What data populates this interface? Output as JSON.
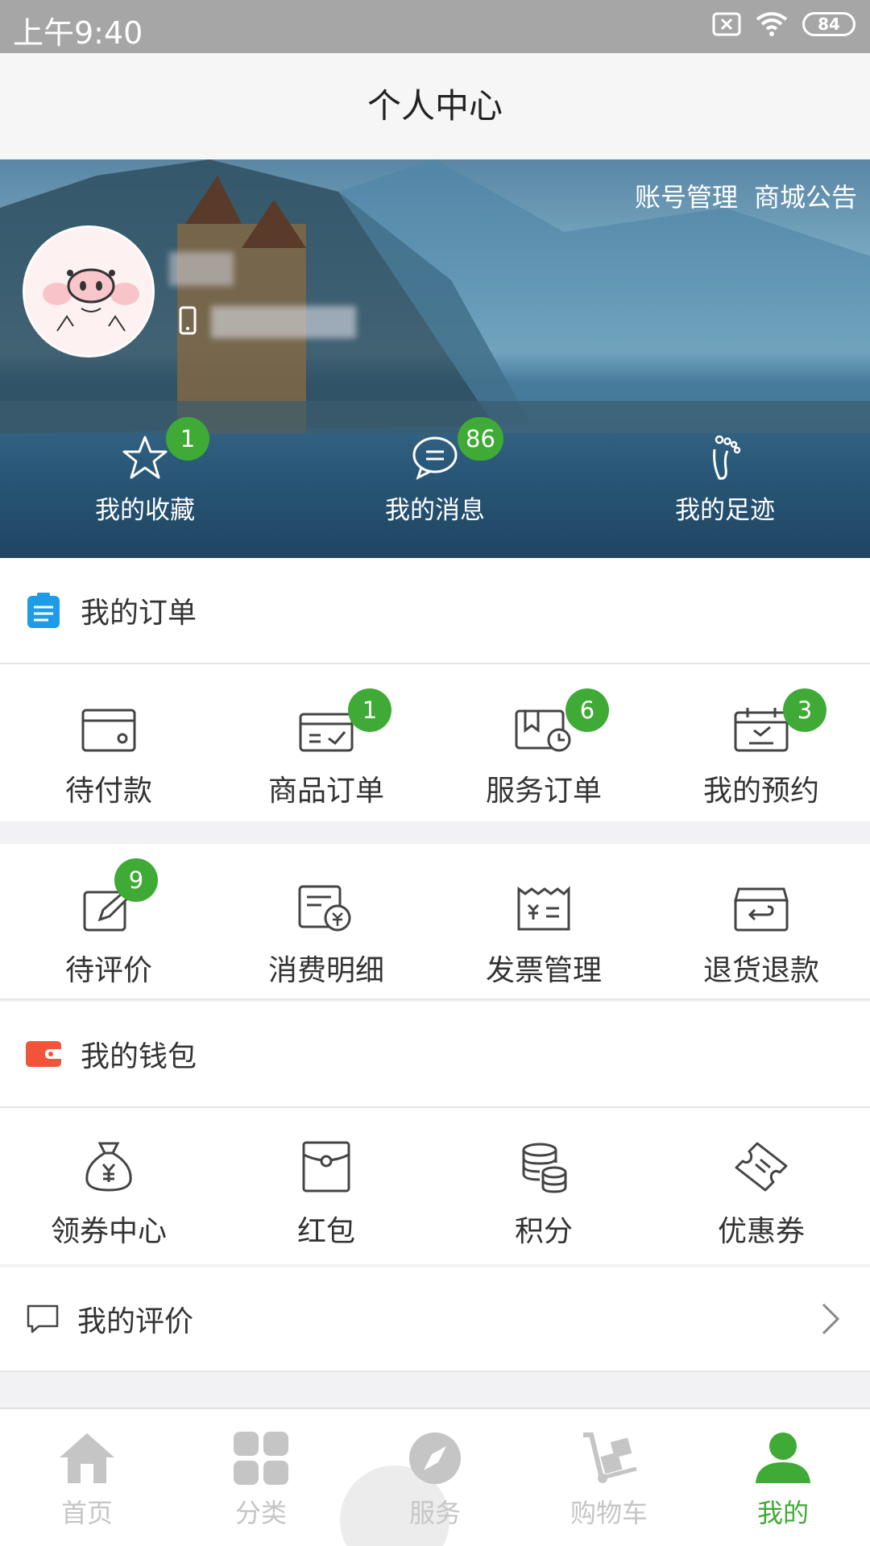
{
  "status_bar": {
    "time": "上午9:40",
    "battery": "84"
  },
  "header": {
    "title": "个人中心"
  },
  "banner": {
    "links": [
      "账号管理",
      "商城公告"
    ],
    "shortcuts": [
      {
        "label": "我的收藏",
        "badge": "1"
      },
      {
        "label": "我的消息",
        "badge": "86"
      },
      {
        "label": "我的足迹"
      }
    ]
  },
  "orders": {
    "title": "我的订单",
    "row1": [
      {
        "label": "待付款"
      },
      {
        "label": "商品订单",
        "badge": "1"
      },
      {
        "label": "服务订单",
        "badge": "6"
      },
      {
        "label": "我的预约",
        "badge": "3"
      }
    ],
    "row2": [
      {
        "label": "待评价",
        "badge": "9"
      },
      {
        "label": "消费明细"
      },
      {
        "label": "发票管理"
      },
      {
        "label": "退货退款"
      }
    ]
  },
  "wallet": {
    "title": "我的钱包",
    "items": [
      {
        "label": "领券中心"
      },
      {
        "label": "红包"
      },
      {
        "label": "积分"
      },
      {
        "label": "优惠券"
      }
    ]
  },
  "reviews_row": {
    "label": "我的评价"
  },
  "tabbar": {
    "items": [
      {
        "label": "首页"
      },
      {
        "label": "分类"
      },
      {
        "label": "服务"
      },
      {
        "label": "购物车"
      },
      {
        "label": "我的"
      }
    ],
    "active_color": "#3faa35",
    "inactive_color": "#c5c5c5"
  },
  "colors": {
    "badge": "#3faa35",
    "order_icon": "#1e9be8",
    "wallet_icon": "#f2543a"
  }
}
